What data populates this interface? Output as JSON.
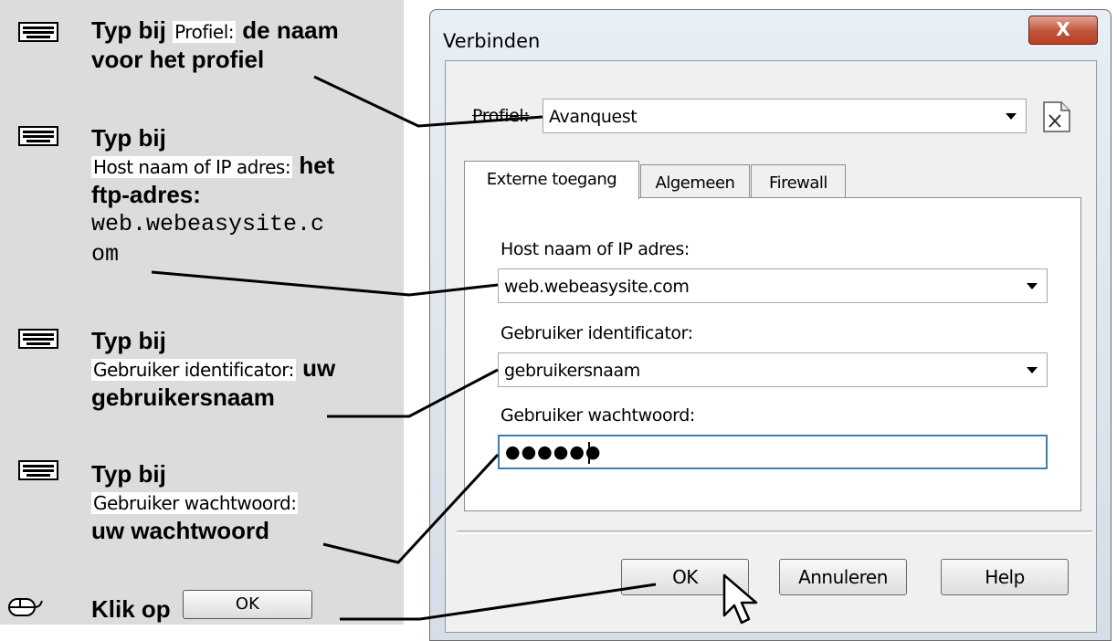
{
  "instructions": {
    "step1": {
      "prefix": "Typ bij",
      "field": "Profiel:",
      "suffix": "de naam",
      "line2": "voor het profiel"
    },
    "step2": {
      "prefix": "Typ bij",
      "field": "Host naam of IP adres:",
      "suffix": "het",
      "line3": "ftp-adres:",
      "value_line1": "web.webeasysite.c",
      "value_line2": "om"
    },
    "step3": {
      "prefix": "Typ bij",
      "field": "Gebruiker identificator:",
      "suffix": "uw",
      "line3": "gebruikersnaam"
    },
    "step4": {
      "prefix": "Typ bij",
      "field": "Gebruiker wachtwoord:",
      "line3": "uw wachtwoord"
    },
    "step5": {
      "prefix": "Klik op",
      "button_label": "OK"
    }
  },
  "dialog": {
    "title": "Verbinden",
    "close_label": "X",
    "profile_label": "Profiel:",
    "profile_value": "Avanquest",
    "tabs": [
      "Externe toegang",
      "Algemeen",
      "Firewall"
    ],
    "active_tab": "Externe toegang",
    "host_label": "Host naam of IP adres:",
    "host_value": "web.webeasysite.com",
    "user_label": "Gebruiker identificator:",
    "user_value": "gebruikersnaam",
    "password_label": "Gebruiker wachtwoord:",
    "password_value": "●●●●●●",
    "buttons": {
      "ok": "OK",
      "cancel": "Annuleren",
      "help": "Help"
    }
  },
  "colors": {
    "left_panel": "#dcdcdc",
    "close_button": "#c0533a",
    "dialog_frame": "#d6dde6"
  }
}
